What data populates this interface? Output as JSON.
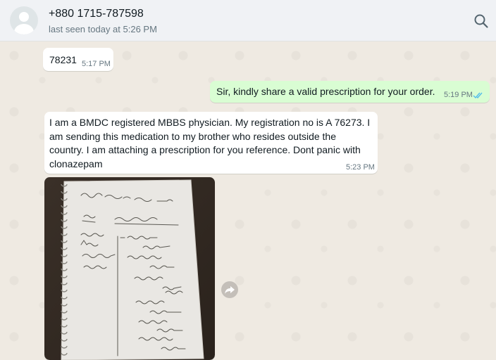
{
  "contact": {
    "name": "+880 1715-787598",
    "status": "last seen today at 5:26 PM"
  },
  "messages": [
    {
      "direction": "incoming",
      "text": "78231",
      "time": "5:17 PM"
    },
    {
      "direction": "outgoing",
      "text": "Sir, kindly share a valid prescription for your order.",
      "time": "5:19 PM",
      "status": "read"
    },
    {
      "direction": "incoming",
      "text": "I am a BMDC registered MBBS physician. My registration no is A 76273. I am sending this medication to my brother who resides outside the country. I am attaching a prescription for you reference. Dont panic with clonazepam",
      "time": "5:23 PM"
    },
    {
      "direction": "incoming",
      "type": "image",
      "image": "handwritten-prescription-notebook-page"
    }
  ],
  "icons": {
    "search": "search-icon",
    "forward": "forward-icon",
    "read_receipt": "double-check-icon",
    "avatar": "default-avatar-icon"
  },
  "colors": {
    "header_bg": "#f0f2f5",
    "chat_bg": "#efeae2",
    "incoming_bubble": "#ffffff",
    "outgoing_bubble": "#d9fdd3",
    "read_tick": "#53bdeb"
  }
}
